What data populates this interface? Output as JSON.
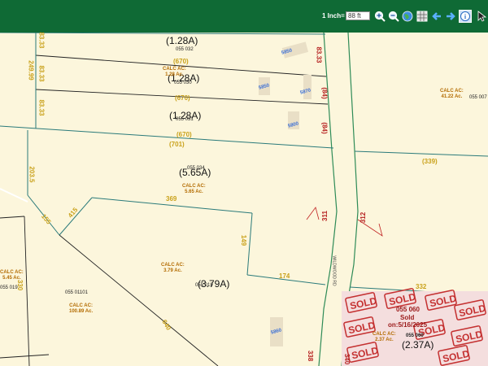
{
  "toolbar": {
    "scale_label": "1 Inch=",
    "scale_value": "88 ft",
    "icons": [
      "zoom-in-icon",
      "zoom-out-icon",
      "globe-icon",
      "back-arrow-icon",
      "forward-arrow-icon",
      "info-icon",
      "pointer-icon"
    ]
  },
  "map": {
    "acreages": [
      "(1.28A)",
      "(1.28A)",
      "(1.28A)",
      "(5.65A)",
      "(3.79A)",
      "(2.37A)"
    ],
    "dimensions_yellow": [
      "83.33",
      "249.99",
      "83.33",
      "83.33",
      "(670)",
      "(670)",
      "(670)",
      "(701)",
      "203.5",
      "155",
      "415",
      "369",
      "149",
      "174",
      "640",
      "(339)",
      "332",
      "330"
    ],
    "dimensions_red": [
      "83.33",
      "(84)",
      "(84)",
      "311",
      "312",
      "338",
      "340"
    ],
    "parcel_ids": [
      "055 032",
      "055 030",
      "055 031",
      "055 034",
      "055 019",
      "055 01101",
      "055 019",
      "055 007",
      "055 060",
      "055 060"
    ],
    "calc_labels": [
      {
        "title": "CALC AC:",
        "value": "1.28 Ac."
      },
      {
        "title": "CALC AC:",
        "value": "41.22 Ac."
      },
      {
        "title": "CALC AC:",
        "value": "5.65 Ac."
      },
      {
        "title": "CALC AC:",
        "value": "3.79 Ac."
      },
      {
        "title": "CALC AC:",
        "value": "5.45 Ac."
      },
      {
        "title": "CALC AC:",
        "value": "100.89 Ac."
      },
      {
        "title": "CALC AC:",
        "value": "2.37 Ac."
      }
    ],
    "addresses": [
      "5850",
      "5850",
      "5870",
      "5800",
      "5860"
    ],
    "road_name": "WILDWOOD RD",
    "sold": {
      "word": "SOLD",
      "parcel": "055 060",
      "status": "Sold",
      "date": "on:5/16/2025"
    }
  },
  "colors": {
    "toolbar": "#0f6a35",
    "map_bg": "#fcf6dc",
    "parcel_line": "#2a7a7a",
    "road_line": "#2e8b57",
    "dim_yellow": "#c9a11a",
    "dim_red": "#b52020",
    "sold_red": "#c43030"
  }
}
